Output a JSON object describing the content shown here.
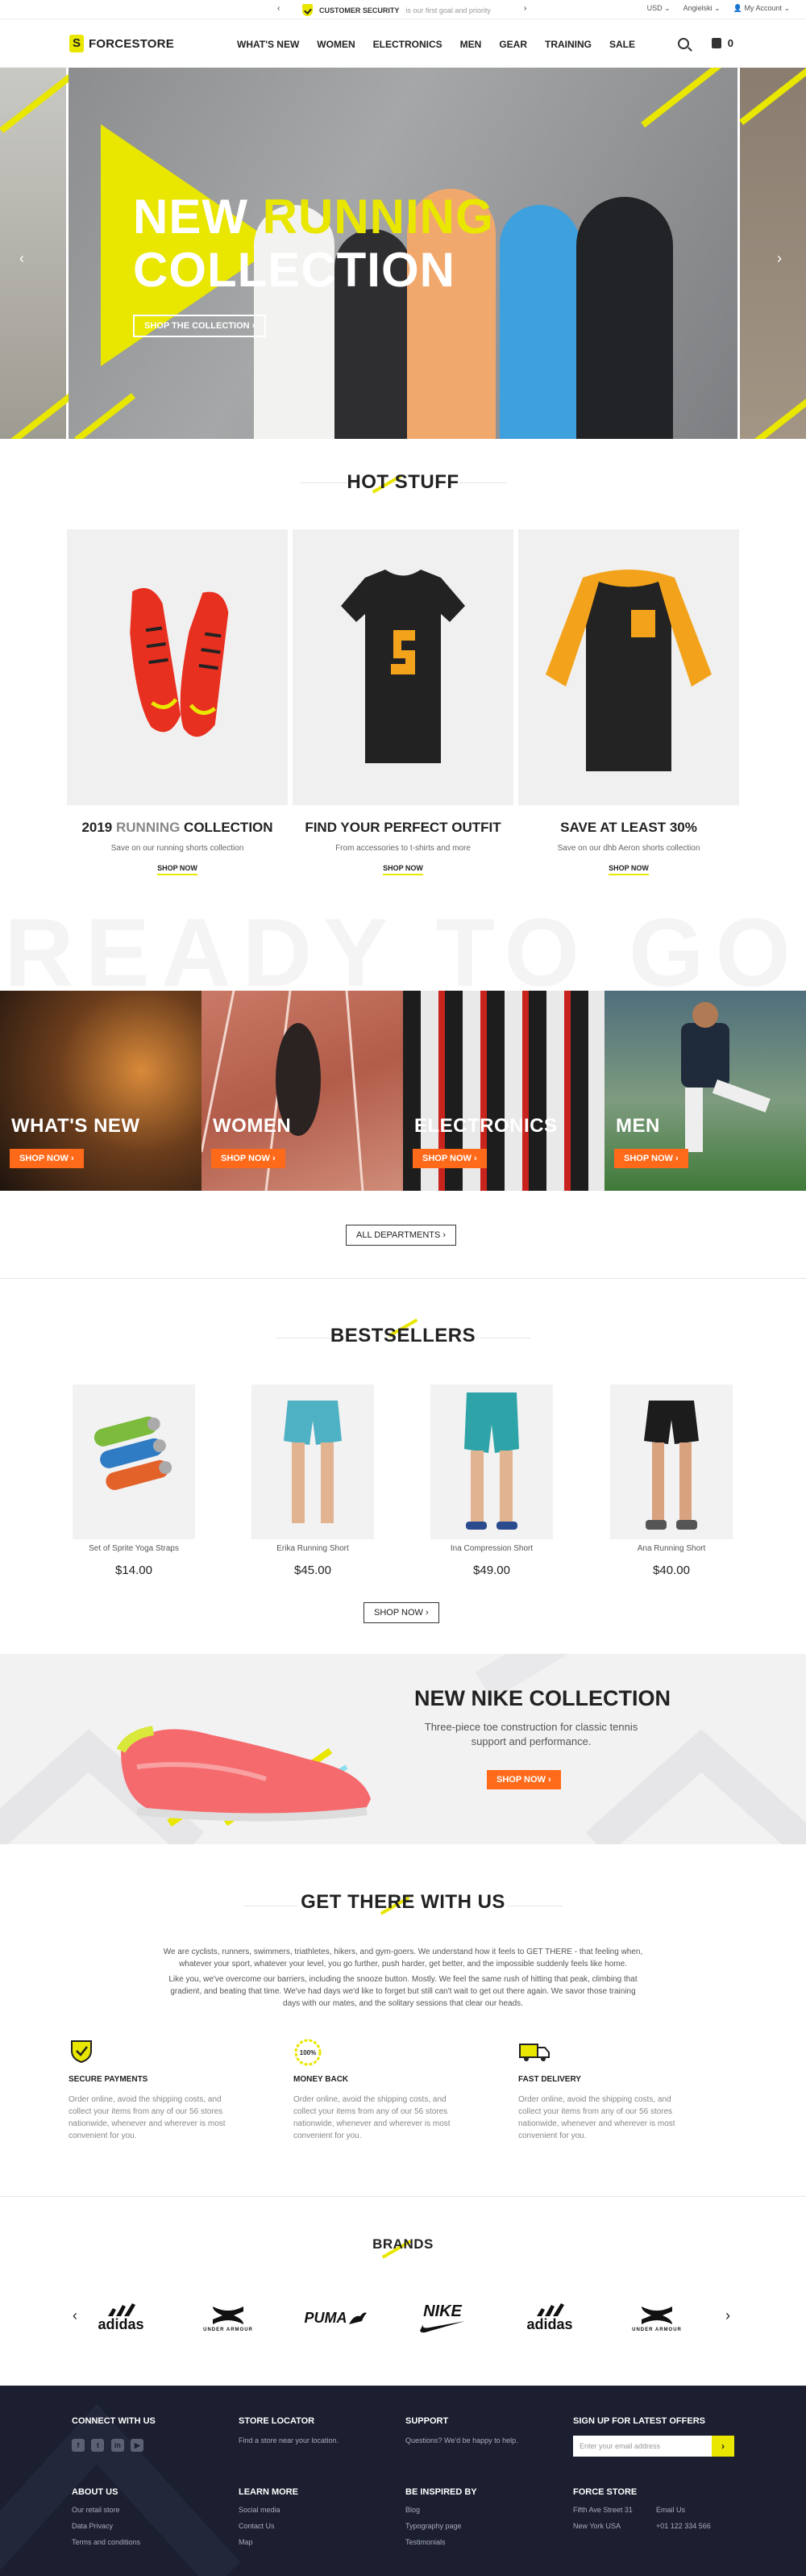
{
  "topbar": {
    "prev_arrow": "‹",
    "next_arrow": "›",
    "message_bold": "CUSTOMER SECURITY",
    "message_rest": "is our first goal and priority",
    "currency": "USD ⌄",
    "language": "Angielski ⌄",
    "account": "My Account ⌄"
  },
  "header": {
    "logo": "FORCESTORE",
    "nav": [
      "WHAT'S NEW",
      "WOMEN",
      "ELECTRONICS",
      "MEN",
      "GEAR",
      "TRAINING",
      "SALE"
    ],
    "cart_count": "0"
  },
  "hero": {
    "title_word1": "NEW",
    "title_word2": "RUNNING",
    "title_line2": "COLLECTION",
    "button": "SHOP THE COLLECTION ›"
  },
  "hot_stuff": {
    "title": "HOT STUFF",
    "cards": [
      {
        "title_a": "2019 ",
        "title_b": "RUNNING",
        "title_c": " COLLECTION",
        "subtitle": "Save on our running shorts collection",
        "link": "SHOP NOW"
      },
      {
        "title_a": "FIND YOUR PERFECT OUTFIT",
        "title_b": "",
        "title_c": "",
        "subtitle": "From accessories to t-shirts and more",
        "link": "SHOP NOW"
      },
      {
        "title_a": "SAVE AT LEAST 30%",
        "title_b": "",
        "title_c": "",
        "subtitle": "Save on our dhb Aeron shorts collection",
        "link": "SHOP NOW"
      }
    ]
  },
  "ready_text": "READY TO GO",
  "categories": [
    {
      "title": "WHAT'S NEW",
      "button": "SHOP NOW ›"
    },
    {
      "title": "WOMEN",
      "button": "SHOP NOW ›"
    },
    {
      "title": "ELECTRONICS",
      "button": "SHOP NOW ›"
    },
    {
      "title": "MEN",
      "button": "SHOP NOW ›"
    }
  ],
  "all_departments": "ALL DEPARTMENTS ›",
  "bestsellers": {
    "title": "BESTSELLERS",
    "items": [
      {
        "name": "Set of Sprite Yoga Straps",
        "price": "$14.00"
      },
      {
        "name": "Erika Running Short",
        "price": "$45.00"
      },
      {
        "name": "Ina Compression Short",
        "price": "$49.00"
      },
      {
        "name": "Ana Running Short",
        "price": "$40.00"
      }
    ],
    "button": "SHOP NOW ›"
  },
  "nike": {
    "title": "NEW NIKE COLLECTION",
    "text": "Three-piece toe construction for classic tennis support and performance.",
    "button": "SHOP NOW ›"
  },
  "get_there": {
    "title": "GET THERE WITH US",
    "p1": "We are cyclists, runners, swimmers, triathletes, hikers, and gym-goers. We understand how it feels to GET THERE - that feeling when, whatever your sport, whatever your level, you go further, push harder, get better, and the impossible suddenly feels like home.",
    "p2": "Like you, we've overcome our barriers, including the snooze button. Mostly. We feel the same rush of hitting that peak, climbing that gradient, and beating that time. We've had days we'd like to forget but still can't wait to get out there again. We savor those training days with our mates, and the solitary sessions that clear our heads.",
    "features": [
      {
        "title": "SECURE PAYMENTS",
        "text": "Order online, avoid the shipping costs, and collect your items from any of our 56 stores nationwide, whenever and wherever is most convenient for you."
      },
      {
        "title": "MONEY BACK",
        "badge": "100%",
        "text": "Order online, avoid the shipping costs, and collect your items from any of our 56 stores nationwide, whenever and wherever is most convenient for you."
      },
      {
        "title": "FAST DELIVERY",
        "text": "Order online, avoid the shipping costs, and collect your items from any of our 56 stores nationwide, whenever and wherever is most convenient for you."
      }
    ]
  },
  "brands": {
    "title": "BRANDS",
    "items": [
      {
        "name": "adidas",
        "sub": ""
      },
      {
        "name": "UNDER ARMOUR",
        "sub": "UNDER ARMOUR"
      },
      {
        "name": "PUMA",
        "sub": ""
      },
      {
        "name": "NIKE",
        "sub": ""
      },
      {
        "name": "adidas",
        "sub": ""
      },
      {
        "name": "UNDER ARMOUR",
        "sub": "UNDER ARMOUR"
      }
    ]
  },
  "footer": {
    "connect": "CONNECT WITH US",
    "social": [
      "f",
      "t",
      "in",
      "▶"
    ],
    "store_locator": "STORE LOCATOR",
    "store_text": "Find a store near your location.",
    "support": "SUPPORT",
    "support_text": "Questions? We'd be happy to help.",
    "signup": "SIGN UP FOR LATEST OFFERS",
    "email_placeholder": "Enter your email address",
    "about": "ABOUT US",
    "about_links": [
      "Our retail store",
      "Data Privacy",
      "Terms and conditions"
    ],
    "learn": "LEARN MORE",
    "learn_links": [
      "Social media",
      "Contact Us",
      "Map"
    ],
    "inspired": "BE INSPIRED BY",
    "inspired_links": [
      "Blog",
      "Typography page",
      "Testimonials"
    ],
    "force": "FORCE STORE",
    "address": [
      "Fifth Ave Street 31",
      "New York USA"
    ],
    "email_label": "Email Us",
    "phone": "+01 122 334 566"
  },
  "colors": {
    "accent": "#e9e600",
    "orange": "#ff6a1a",
    "footer_bg": "#1b1f30"
  }
}
